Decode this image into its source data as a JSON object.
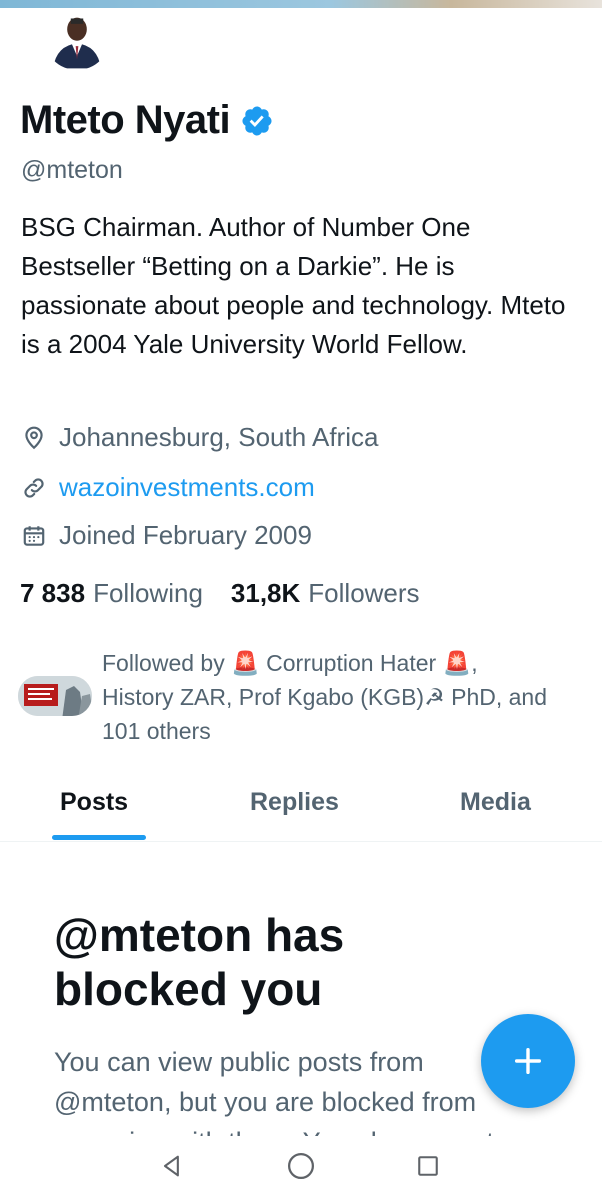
{
  "profile": {
    "name": "Mteto Nyati",
    "handle": "@mteton",
    "bio": "BSG Chairman. Author of Number One Bestseller “Betting on a Darkie”. He is passionate about people and technology. Mteto is a 2004 Yale University World Fellow.",
    "location": "Johannesburg, South Africa",
    "website": "wazoinvestments.com",
    "joined": "Joined February 2009",
    "following_count": "7 838",
    "following_label": "Following",
    "followers_count": "31,8K",
    "followers_label": "Followers",
    "verified_icon": "verified-badge-icon"
  },
  "followed_by": {
    "line1": "Followed by 🚨 Corruption Hater 🚨,",
    "line2": "History ZAR, Prof Kgabo (KGB)☭ PhD, and",
    "line3": "101 others"
  },
  "tabs": [
    {
      "label": "Posts",
      "active": true
    },
    {
      "label": "Replies",
      "active": false
    },
    {
      "label": "Media",
      "active": false
    }
  ],
  "blocked": {
    "title": "@mteton has blocked you",
    "description": "You can view public posts from @mteton, but you are blocked from engaging with them. You also cannot"
  },
  "colors": {
    "accent": "#1d9bf0",
    "text_primary": "#0f1419",
    "text_secondary": "#536471"
  },
  "icons": {
    "location": "location-pin-icon",
    "link": "link-icon",
    "calendar": "calendar-icon",
    "compose": "plus-icon",
    "nav_back": "back-triangle-icon",
    "nav_home": "home-circle-icon",
    "nav_recent": "recent-square-icon"
  }
}
